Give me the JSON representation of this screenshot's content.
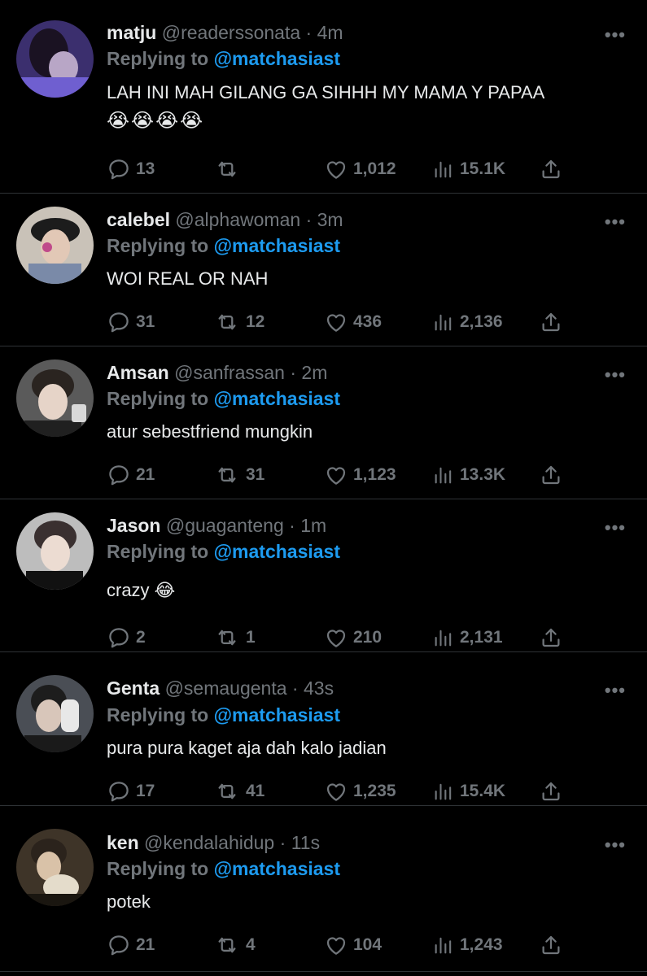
{
  "tweets": [
    {
      "name": "matju",
      "handle": "@readerssonata",
      "time": "4m",
      "replying_prefix": "Replying to",
      "replying_to": "@matchasiast",
      "text": "LAH INI MAH GILANG GA SIHHH MY MAMA Y PAPAA",
      "emoji_line": "😭😭😭😭",
      "replies": "13",
      "retweets": "",
      "likes": "1,012",
      "views": "15.1K",
      "more": "•••"
    },
    {
      "name": "calebel",
      "handle": "@alphawoman",
      "time": "3m",
      "replying_prefix": "Replying to",
      "replying_to": "@matchasiast",
      "text": "WOI REAL OR NAH",
      "replies": "31",
      "retweets": "12",
      "likes": "436",
      "views": "2,136",
      "more": "•••"
    },
    {
      "name": "Amsan",
      "handle": "@sanfrassan",
      "time": "2m",
      "replying_prefix": "Replying to",
      "replying_to": "@matchasiast",
      "text": "atur sebestfriend mungkin",
      "replies": "21",
      "retweets": "31",
      "likes": "1,123",
      "views": "13.3K",
      "more": "•••"
    },
    {
      "name": "Jason",
      "handle": "@guaganteng",
      "time": "1m",
      "replying_prefix": "Replying to",
      "replying_to": "@matchasiast",
      "text": "crazy 😂",
      "replies": "2",
      "retweets": "1",
      "likes": "210",
      "views": "2,131",
      "more": "•••"
    },
    {
      "name": "Genta",
      "handle": "@semaugenta",
      "time": "43s",
      "replying_prefix": "Replying to",
      "replying_to": "@matchasiast",
      "text": "pura pura kaget aja dah kalo jadian",
      "replies": "17",
      "retweets": "41",
      "likes": "1,235",
      "views": "15.4K",
      "more": "•••"
    },
    {
      "name": "ken",
      "handle": "@kendalahidup",
      "time": "11s",
      "replying_prefix": "Replying to",
      "replying_to": "@matchasiast",
      "text": "potek",
      "replies": "21",
      "retweets": "4",
      "likes": "104",
      "views": "1,243",
      "more": "•••"
    }
  ],
  "colors": {
    "background": "#000000",
    "text": "#e7e9ea",
    "muted": "#71767b",
    "mention": "#1d9bf0",
    "divider": "#2f3336"
  },
  "icons": [
    "reply-icon",
    "retweet-icon",
    "like-icon",
    "views-icon",
    "share-icon",
    "more-icon"
  ]
}
